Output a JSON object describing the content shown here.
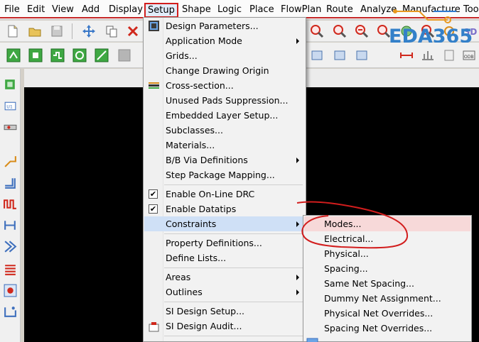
{
  "menubar": {
    "items": [
      "File",
      "Edit",
      "View",
      "Add",
      "Display",
      "Setup",
      "Shape",
      "Logic",
      "Place",
      "FlowPlan",
      "Route",
      "Analyze",
      "Manufacture",
      "Too"
    ]
  },
  "watermark": "EDA365",
  "setup_menu": {
    "items": [
      "Design Parameters...",
      "Application Mode",
      "Grids...",
      "Change Drawing Origin",
      "Cross-section...",
      "Unused Pads Suppression...",
      "Embedded Layer Setup...",
      "Subclasses...",
      "Materials...",
      "B/B Via Definitions",
      "Step Package Mapping...",
      "Enable On-Line DRC",
      "Enable Datatips",
      "Constraints",
      "Property Definitions...",
      "Define Lists...",
      "Areas",
      "Outlines",
      "SI Design Setup...",
      "SI Design Audit..."
    ]
  },
  "constraints_menu": {
    "items": [
      "Modes...",
      "Electrical...",
      "Physical...",
      "Spacing...",
      "Same Net Spacing...",
      "Dummy Net Assignment...",
      "Physical Net Overrides...",
      "Spacing Net Overrides..."
    ]
  },
  "annotation_color": "#d21d1d",
  "accent_color": "#3380c9",
  "selection_color": "#cfe0f6"
}
